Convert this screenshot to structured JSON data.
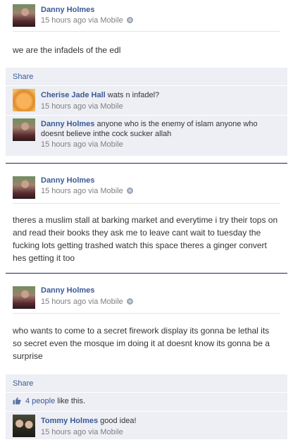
{
  "posts": [
    {
      "author": "Danny Holmes",
      "meta": "15 hours ago via Mobile",
      "text": "we are the infadels of the edl",
      "share_label": "Share",
      "comments": [
        {
          "author": "Cherise Jade Hall",
          "text": "wats n infadel?",
          "meta": "15 hours ago via Mobile"
        },
        {
          "author": "Danny Holmes",
          "text": "anyone who is the enemy of islam anyone who doesnt believe inthe cock sucker allah",
          "meta": "15 hours ago via Mobile"
        }
      ]
    },
    {
      "author": "Danny Holmes",
      "meta": "15 hours ago via Mobile",
      "text": "theres a muslim stall at barking market and everytime i try their tops on and read their books they ask me to leave cant wait to tuesday the fucking lots getting trashed watch this space theres a ginger convert hes getting it too"
    },
    {
      "author": "Danny Holmes",
      "meta": "15 hours ago via Mobile",
      "text": "who wants to come to a secret firework display its gonna be lethal its so secret even the mosque im doing it at doesnt know its gonna be a surprise",
      "share_label": "Share",
      "likes": {
        "count": "4 people",
        "suffix": " like this."
      },
      "comments": [
        {
          "author": "Tommy Holmes",
          "text": "good idea!",
          "meta": "15 hours ago via Mobile"
        }
      ]
    }
  ],
  "icons": {
    "privacy": "globe-icon",
    "like": "thumbs-up-icon"
  },
  "colors": {
    "link": "#3b5998",
    "panel": "#edeff4",
    "meta": "#808080",
    "divider": "#1d2a5b"
  }
}
